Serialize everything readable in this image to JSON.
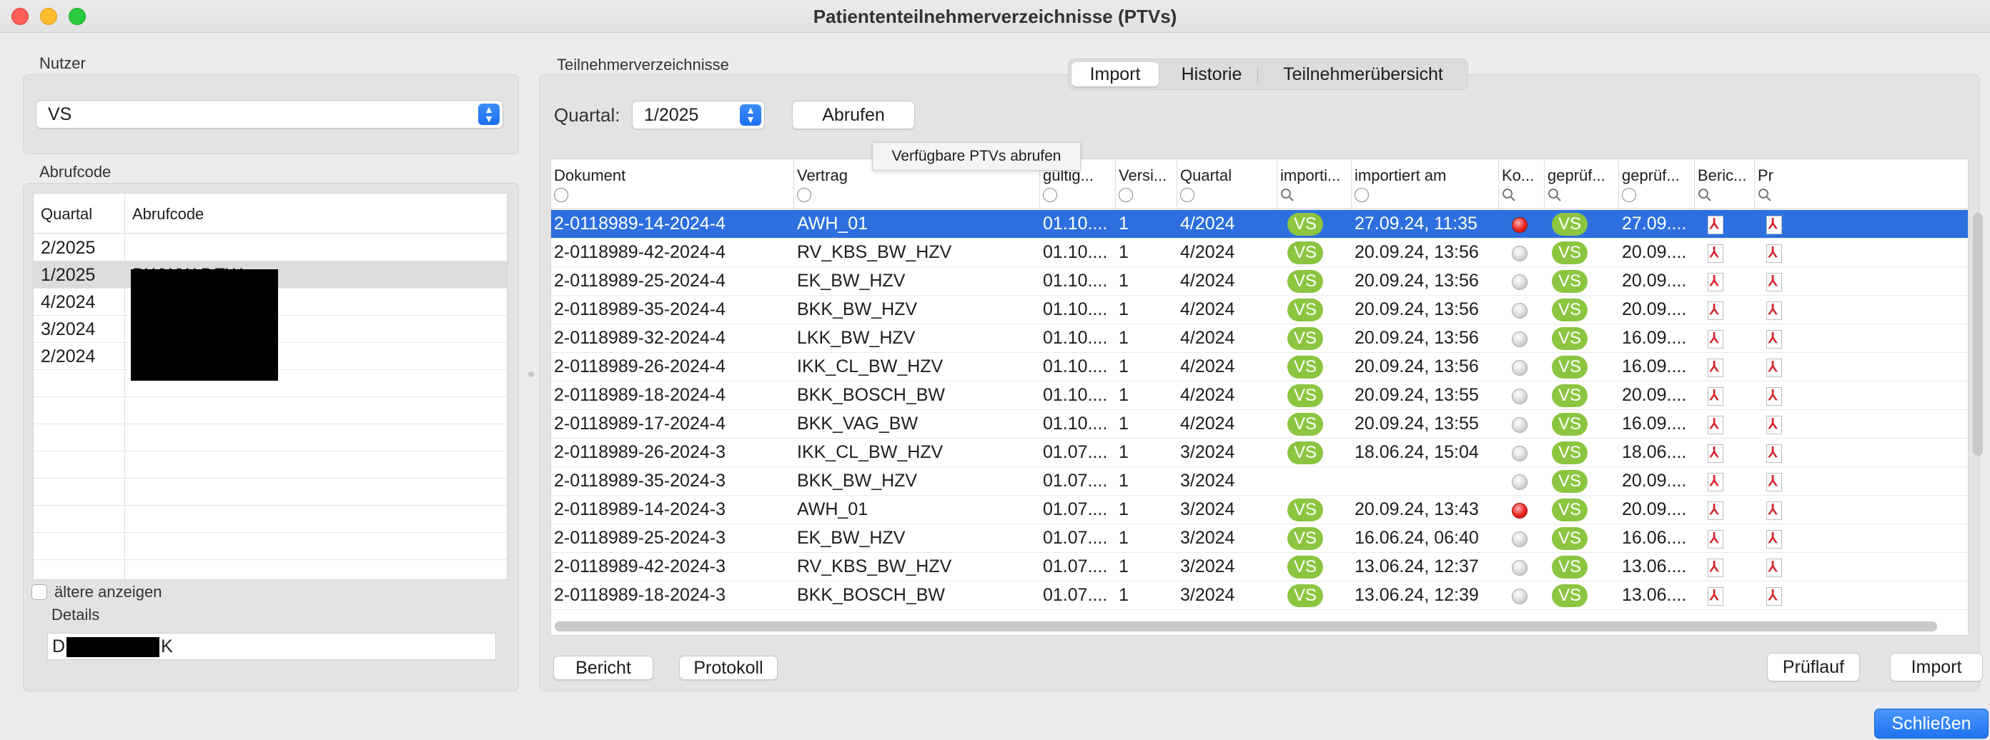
{
  "window": {
    "title": "Patiententeilnehmerverzeichnisse (PTVs)"
  },
  "left": {
    "nutzer_label": "Nutzer",
    "nutzer_value": "VS",
    "abrufcode_label": "Abrufcode",
    "table": {
      "headers": [
        "Quartal",
        "Abrufcode"
      ],
      "rows": [
        {
          "quartal": "2/2025",
          "code": ""
        },
        {
          "quartal": "1/2025",
          "code": "DWWW DEW"
        },
        {
          "quartal": "4/2024",
          "code": ""
        },
        {
          "quartal": "3/2024",
          "code": ""
        },
        {
          "quartal": "2/2024",
          "code": ""
        }
      ]
    },
    "older_label": "ältere anzeigen",
    "details_label": "Details",
    "details_value_start": "D",
    "details_value_end": "K"
  },
  "main": {
    "section_label": "Teilnehmerverzeichnisse",
    "tabs": [
      "Import",
      "Historie",
      "Teilnehmerübersicht"
    ],
    "quartal_label": "Quartal:",
    "quartal_value": "1/2025",
    "abrufen_label": "Abrufen",
    "tooltip": "Verfügbare PTVs abrufen",
    "columns": [
      "Dokument",
      "Vertrag",
      "gültig...",
      "Versi...",
      "Quartal",
      "importi...",
      "importiert am",
      "Ko...",
      "geprüf...",
      "geprüf...",
      "Beric...",
      "Pr"
    ],
    "rows": [
      {
        "dok": "2-0118989-14-2024-4",
        "vertrag": "AWH_01",
        "gueltig": "01.10....",
        "vers": "1",
        "quartal": "4/2024",
        "imp": "VS",
        "imp_am": "27.09.24, 11:35",
        "ko": "red",
        "gepr": "VS",
        "gepr_am": "27.09...."
      },
      {
        "dok": "2-0118989-42-2024-4",
        "vertrag": "RV_KBS_BW_HZV",
        "gueltig": "01.10....",
        "vers": "1",
        "quartal": "4/2024",
        "imp": "VS",
        "imp_am": "20.09.24, 13:56",
        "ko": "grey",
        "gepr": "VS",
        "gepr_am": "20.09...."
      },
      {
        "dok": "2-0118989-25-2024-4",
        "vertrag": "EK_BW_HZV",
        "gueltig": "01.10....",
        "vers": "1",
        "quartal": "4/2024",
        "imp": "VS",
        "imp_am": "20.09.24, 13:56",
        "ko": "grey",
        "gepr": "VS",
        "gepr_am": "20.09...."
      },
      {
        "dok": "2-0118989-35-2024-4",
        "vertrag": "BKK_BW_HZV",
        "gueltig": "01.10....",
        "vers": "1",
        "quartal": "4/2024",
        "imp": "VS",
        "imp_am": "20.09.24, 13:56",
        "ko": "grey",
        "gepr": "VS",
        "gepr_am": "20.09...."
      },
      {
        "dok": "2-0118989-32-2024-4",
        "vertrag": "LKK_BW_HZV",
        "gueltig": "01.10....",
        "vers": "1",
        "quartal": "4/2024",
        "imp": "VS",
        "imp_am": "20.09.24, 13:56",
        "ko": "grey",
        "gepr": "VS",
        "gepr_am": "16.09...."
      },
      {
        "dok": "2-0118989-26-2024-4",
        "vertrag": "IKK_CL_BW_HZV",
        "gueltig": "01.10....",
        "vers": "1",
        "quartal": "4/2024",
        "imp": "VS",
        "imp_am": "20.09.24, 13:56",
        "ko": "grey",
        "gepr": "VS",
        "gepr_am": "16.09...."
      },
      {
        "dok": "2-0118989-18-2024-4",
        "vertrag": "BKK_BOSCH_BW",
        "gueltig": "01.10....",
        "vers": "1",
        "quartal": "4/2024",
        "imp": "VS",
        "imp_am": "20.09.24, 13:55",
        "ko": "grey",
        "gepr": "VS",
        "gepr_am": "20.09...."
      },
      {
        "dok": "2-0118989-17-2024-4",
        "vertrag": "BKK_VAG_BW",
        "gueltig": "01.10....",
        "vers": "1",
        "quartal": "4/2024",
        "imp": "VS",
        "imp_am": "20.09.24, 13:55",
        "ko": "grey",
        "gepr": "VS",
        "gepr_am": "16.09...."
      },
      {
        "dok": "2-0118989-26-2024-3",
        "vertrag": "IKK_CL_BW_HZV",
        "gueltig": "01.07....",
        "vers": "1",
        "quartal": "3/2024",
        "imp": "VS",
        "imp_am": "18.06.24, 15:04",
        "ko": "grey",
        "gepr": "VS",
        "gepr_am": "18.06...."
      },
      {
        "dok": "2-0118989-35-2024-3",
        "vertrag": "BKK_BW_HZV",
        "gueltig": "01.07....",
        "vers": "1",
        "quartal": "3/2024",
        "imp": "",
        "imp_am": "",
        "ko": "grey",
        "gepr": "VS",
        "gepr_am": "20.09...."
      },
      {
        "dok": "2-0118989-14-2024-3",
        "vertrag": "AWH_01",
        "gueltig": "01.07....",
        "vers": "1",
        "quartal": "3/2024",
        "imp": "VS",
        "imp_am": "20.09.24, 13:43",
        "ko": "red",
        "gepr": "VS",
        "gepr_am": "20.09...."
      },
      {
        "dok": "2-0118989-25-2024-3",
        "vertrag": "EK_BW_HZV",
        "gueltig": "01.07....",
        "vers": "1",
        "quartal": "3/2024",
        "imp": "VS",
        "imp_am": "16.06.24, 06:40",
        "ko": "grey",
        "gepr": "VS",
        "gepr_am": "16.06...."
      },
      {
        "dok": "2-0118989-42-2024-3",
        "vertrag": "RV_KBS_BW_HZV",
        "gueltig": "01.07....",
        "vers": "1",
        "quartal": "3/2024",
        "imp": "VS",
        "imp_am": "13.06.24, 12:37",
        "ko": "grey",
        "gepr": "VS",
        "gepr_am": "13.06...."
      },
      {
        "dok": "2-0118989-18-2024-3",
        "vertrag": "BKK_BOSCH_BW",
        "gueltig": "01.07....",
        "vers": "1",
        "quartal": "3/2024",
        "imp": "VS",
        "imp_am": "13.06.24, 12:39",
        "ko": "grey",
        "gepr": "VS",
        "gepr_am": "13.06...."
      }
    ],
    "bericht_label": "Bericht",
    "protokoll_label": "Protokoll",
    "prueflauf_label": "Prüflauf",
    "import_label": "Import"
  },
  "footer": {
    "close_label": "Schließen"
  },
  "colors": {
    "accent": "#2d6fde",
    "vs_badge": "#8cc540",
    "led_red": "#e8221c"
  }
}
